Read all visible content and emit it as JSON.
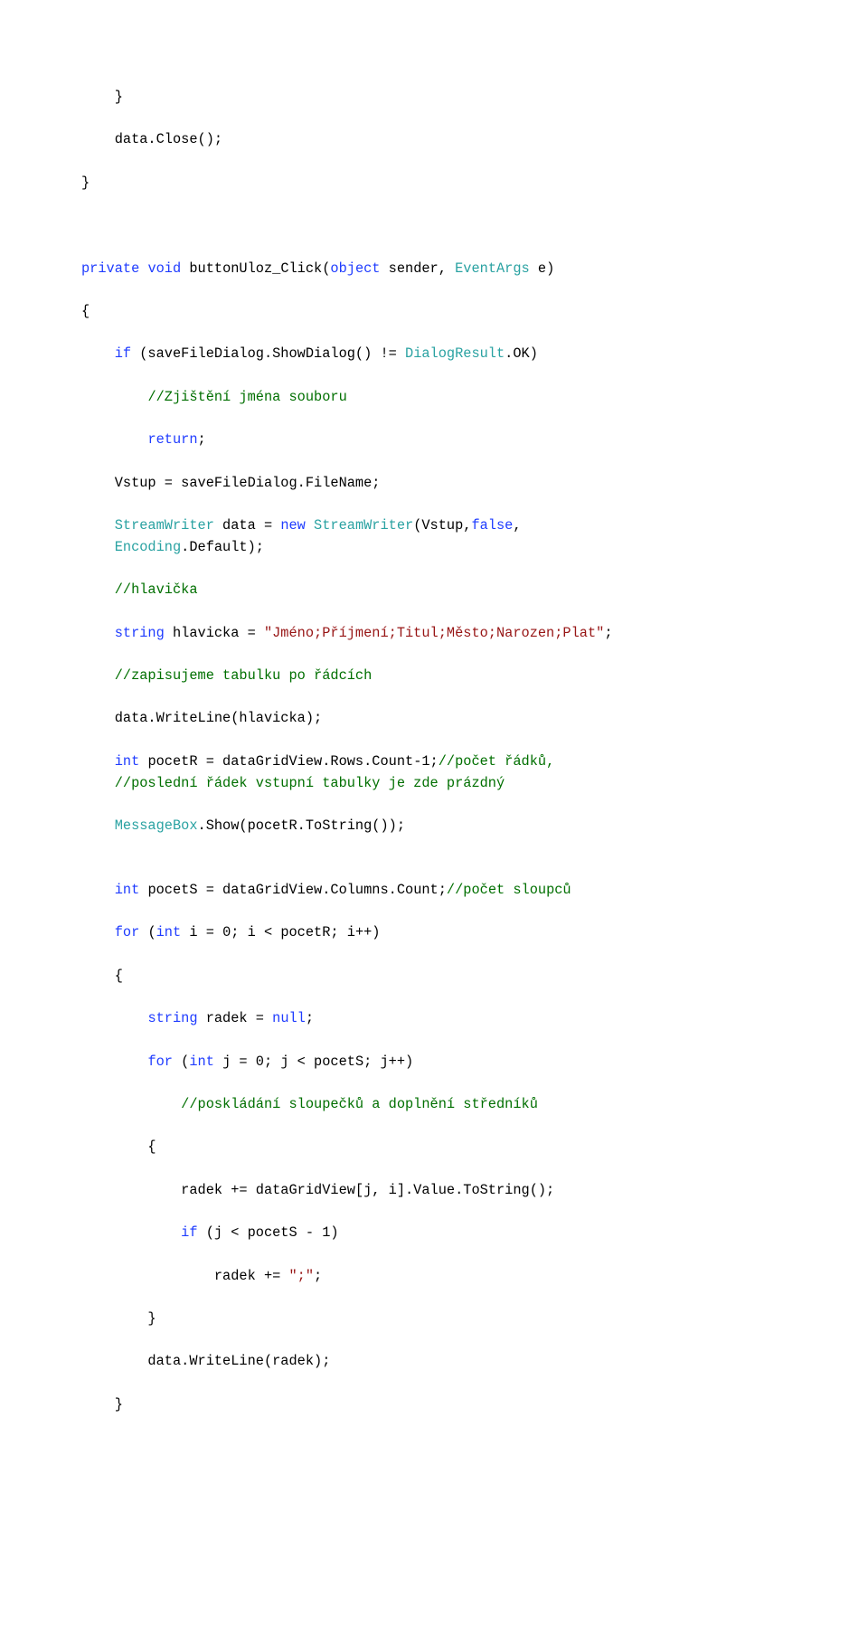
{
  "lines": [
    [
      [
        "txt",
        "    }"
      ]
    ],
    [
      [
        "txt",
        ""
      ]
    ],
    [
      [
        "txt",
        "    data.Close();"
      ]
    ],
    [
      [
        "txt",
        ""
      ]
    ],
    [
      [
        "txt",
        "}"
      ]
    ],
    [
      [
        "txt",
        ""
      ]
    ],
    [
      [
        "txt",
        ""
      ]
    ],
    [
      [
        "txt",
        ""
      ]
    ],
    [
      [
        "kw",
        "private"
      ],
      [
        "txt",
        " "
      ],
      [
        "kw",
        "void"
      ],
      [
        "txt",
        " buttonUloz_Click("
      ],
      [
        "kw",
        "object"
      ],
      [
        "txt",
        " sender, "
      ],
      [
        "type",
        "EventArgs"
      ],
      [
        "txt",
        " e)"
      ]
    ],
    [
      [
        "txt",
        ""
      ]
    ],
    [
      [
        "txt",
        "{"
      ]
    ],
    [
      [
        "txt",
        ""
      ]
    ],
    [
      [
        "txt",
        "    "
      ],
      [
        "kw",
        "if"
      ],
      [
        "txt",
        " (saveFileDialog.ShowDialog() != "
      ],
      [
        "type",
        "DialogResult"
      ],
      [
        "txt",
        ".OK)"
      ]
    ],
    [
      [
        "txt",
        ""
      ]
    ],
    [
      [
        "txt",
        "        "
      ],
      [
        "com",
        "//Zjištění jména souboru"
      ]
    ],
    [
      [
        "txt",
        ""
      ]
    ],
    [
      [
        "txt",
        "        "
      ],
      [
        "kw",
        "return"
      ],
      [
        "txt",
        ";"
      ]
    ],
    [
      [
        "txt",
        ""
      ]
    ],
    [
      [
        "txt",
        "    Vstup = saveFileDialog.FileName;"
      ]
    ],
    [
      [
        "txt",
        ""
      ]
    ],
    [
      [
        "txt",
        "    "
      ],
      [
        "type",
        "StreamWriter"
      ],
      [
        "txt",
        " data = "
      ],
      [
        "kw",
        "new"
      ],
      [
        "txt",
        " "
      ],
      [
        "type",
        "StreamWriter"
      ],
      [
        "txt",
        "(Vstup,"
      ],
      [
        "kw",
        "false"
      ],
      [
        "txt",
        ","
      ]
    ],
    [
      [
        "txt",
        "    "
      ],
      [
        "type",
        "Encoding"
      ],
      [
        "txt",
        ".Default);"
      ]
    ],
    [
      [
        "txt",
        ""
      ]
    ],
    [
      [
        "txt",
        "    "
      ],
      [
        "com",
        "//hlavička"
      ]
    ],
    [
      [
        "txt",
        ""
      ]
    ],
    [
      [
        "txt",
        "    "
      ],
      [
        "kw",
        "string"
      ],
      [
        "txt",
        " hlavicka = "
      ],
      [
        "str",
        "\"Jméno;Příjmení;Titul;Město;Narozen;Plat\""
      ],
      [
        "txt",
        ";"
      ]
    ],
    [
      [
        "txt",
        ""
      ]
    ],
    [
      [
        "txt",
        "    "
      ],
      [
        "com",
        "//zapisujeme tabulku po řádcích"
      ]
    ],
    [
      [
        "txt",
        ""
      ]
    ],
    [
      [
        "txt",
        "    data.WriteLine(hlavicka);"
      ]
    ],
    [
      [
        "txt",
        ""
      ]
    ],
    [
      [
        "txt",
        "    "
      ],
      [
        "kw",
        "int"
      ],
      [
        "txt",
        " pocetR = dataGridView.Rows.Count-1;"
      ],
      [
        "com",
        "//počet řádků,"
      ]
    ],
    [
      [
        "txt",
        "    "
      ],
      [
        "com",
        "//poslední řádek vstupní tabulky je zde prázdný"
      ]
    ],
    [
      [
        "txt",
        ""
      ]
    ],
    [
      [
        "txt",
        "    "
      ],
      [
        "type",
        "MessageBox"
      ],
      [
        "txt",
        ".Show(pocetR.ToString());"
      ]
    ],
    [
      [
        "txt",
        ""
      ]
    ],
    [
      [
        "txt",
        ""
      ]
    ],
    [
      [
        "txt",
        "    "
      ],
      [
        "kw",
        "int"
      ],
      [
        "txt",
        " pocetS = dataGridView.Columns.Count;"
      ],
      [
        "com",
        "//počet sloupců"
      ]
    ],
    [
      [
        "txt",
        ""
      ]
    ],
    [
      [
        "txt",
        "    "
      ],
      [
        "kw",
        "for"
      ],
      [
        "txt",
        " ("
      ],
      [
        "kw",
        "int"
      ],
      [
        "txt",
        " i = 0; i < pocetR; i++)"
      ]
    ],
    [
      [
        "txt",
        ""
      ]
    ],
    [
      [
        "txt",
        "    {"
      ]
    ],
    [
      [
        "txt",
        ""
      ]
    ],
    [
      [
        "txt",
        "        "
      ],
      [
        "kw",
        "string"
      ],
      [
        "txt",
        " radek = "
      ],
      [
        "kw",
        "null"
      ],
      [
        "txt",
        ";"
      ]
    ],
    [
      [
        "txt",
        ""
      ]
    ],
    [
      [
        "txt",
        "        "
      ],
      [
        "kw",
        "for"
      ],
      [
        "txt",
        " ("
      ],
      [
        "kw",
        "int"
      ],
      [
        "txt",
        " j = 0; j < pocetS; j++)"
      ]
    ],
    [
      [
        "txt",
        ""
      ]
    ],
    [
      [
        "txt",
        "            "
      ],
      [
        "com",
        "//poskládání sloupečků a doplnění středníků"
      ]
    ],
    [
      [
        "txt",
        ""
      ]
    ],
    [
      [
        "txt",
        "        {"
      ]
    ],
    [
      [
        "txt",
        ""
      ]
    ],
    [
      [
        "txt",
        "            radek += dataGridView[j, i].Value.ToString();"
      ]
    ],
    [
      [
        "txt",
        ""
      ]
    ],
    [
      [
        "txt",
        "            "
      ],
      [
        "kw",
        "if"
      ],
      [
        "txt",
        " (j < pocetS - 1)"
      ]
    ],
    [
      [
        "txt",
        ""
      ]
    ],
    [
      [
        "txt",
        "                radek += "
      ],
      [
        "str",
        "\";\""
      ],
      [
        "txt",
        ";"
      ]
    ],
    [
      [
        "txt",
        ""
      ]
    ],
    [
      [
        "txt",
        "        }"
      ]
    ],
    [
      [
        "txt",
        ""
      ]
    ],
    [
      [
        "txt",
        "        data.WriteLine(radek);"
      ]
    ],
    [
      [
        "txt",
        ""
      ]
    ],
    [
      [
        "txt",
        "    }"
      ]
    ]
  ]
}
